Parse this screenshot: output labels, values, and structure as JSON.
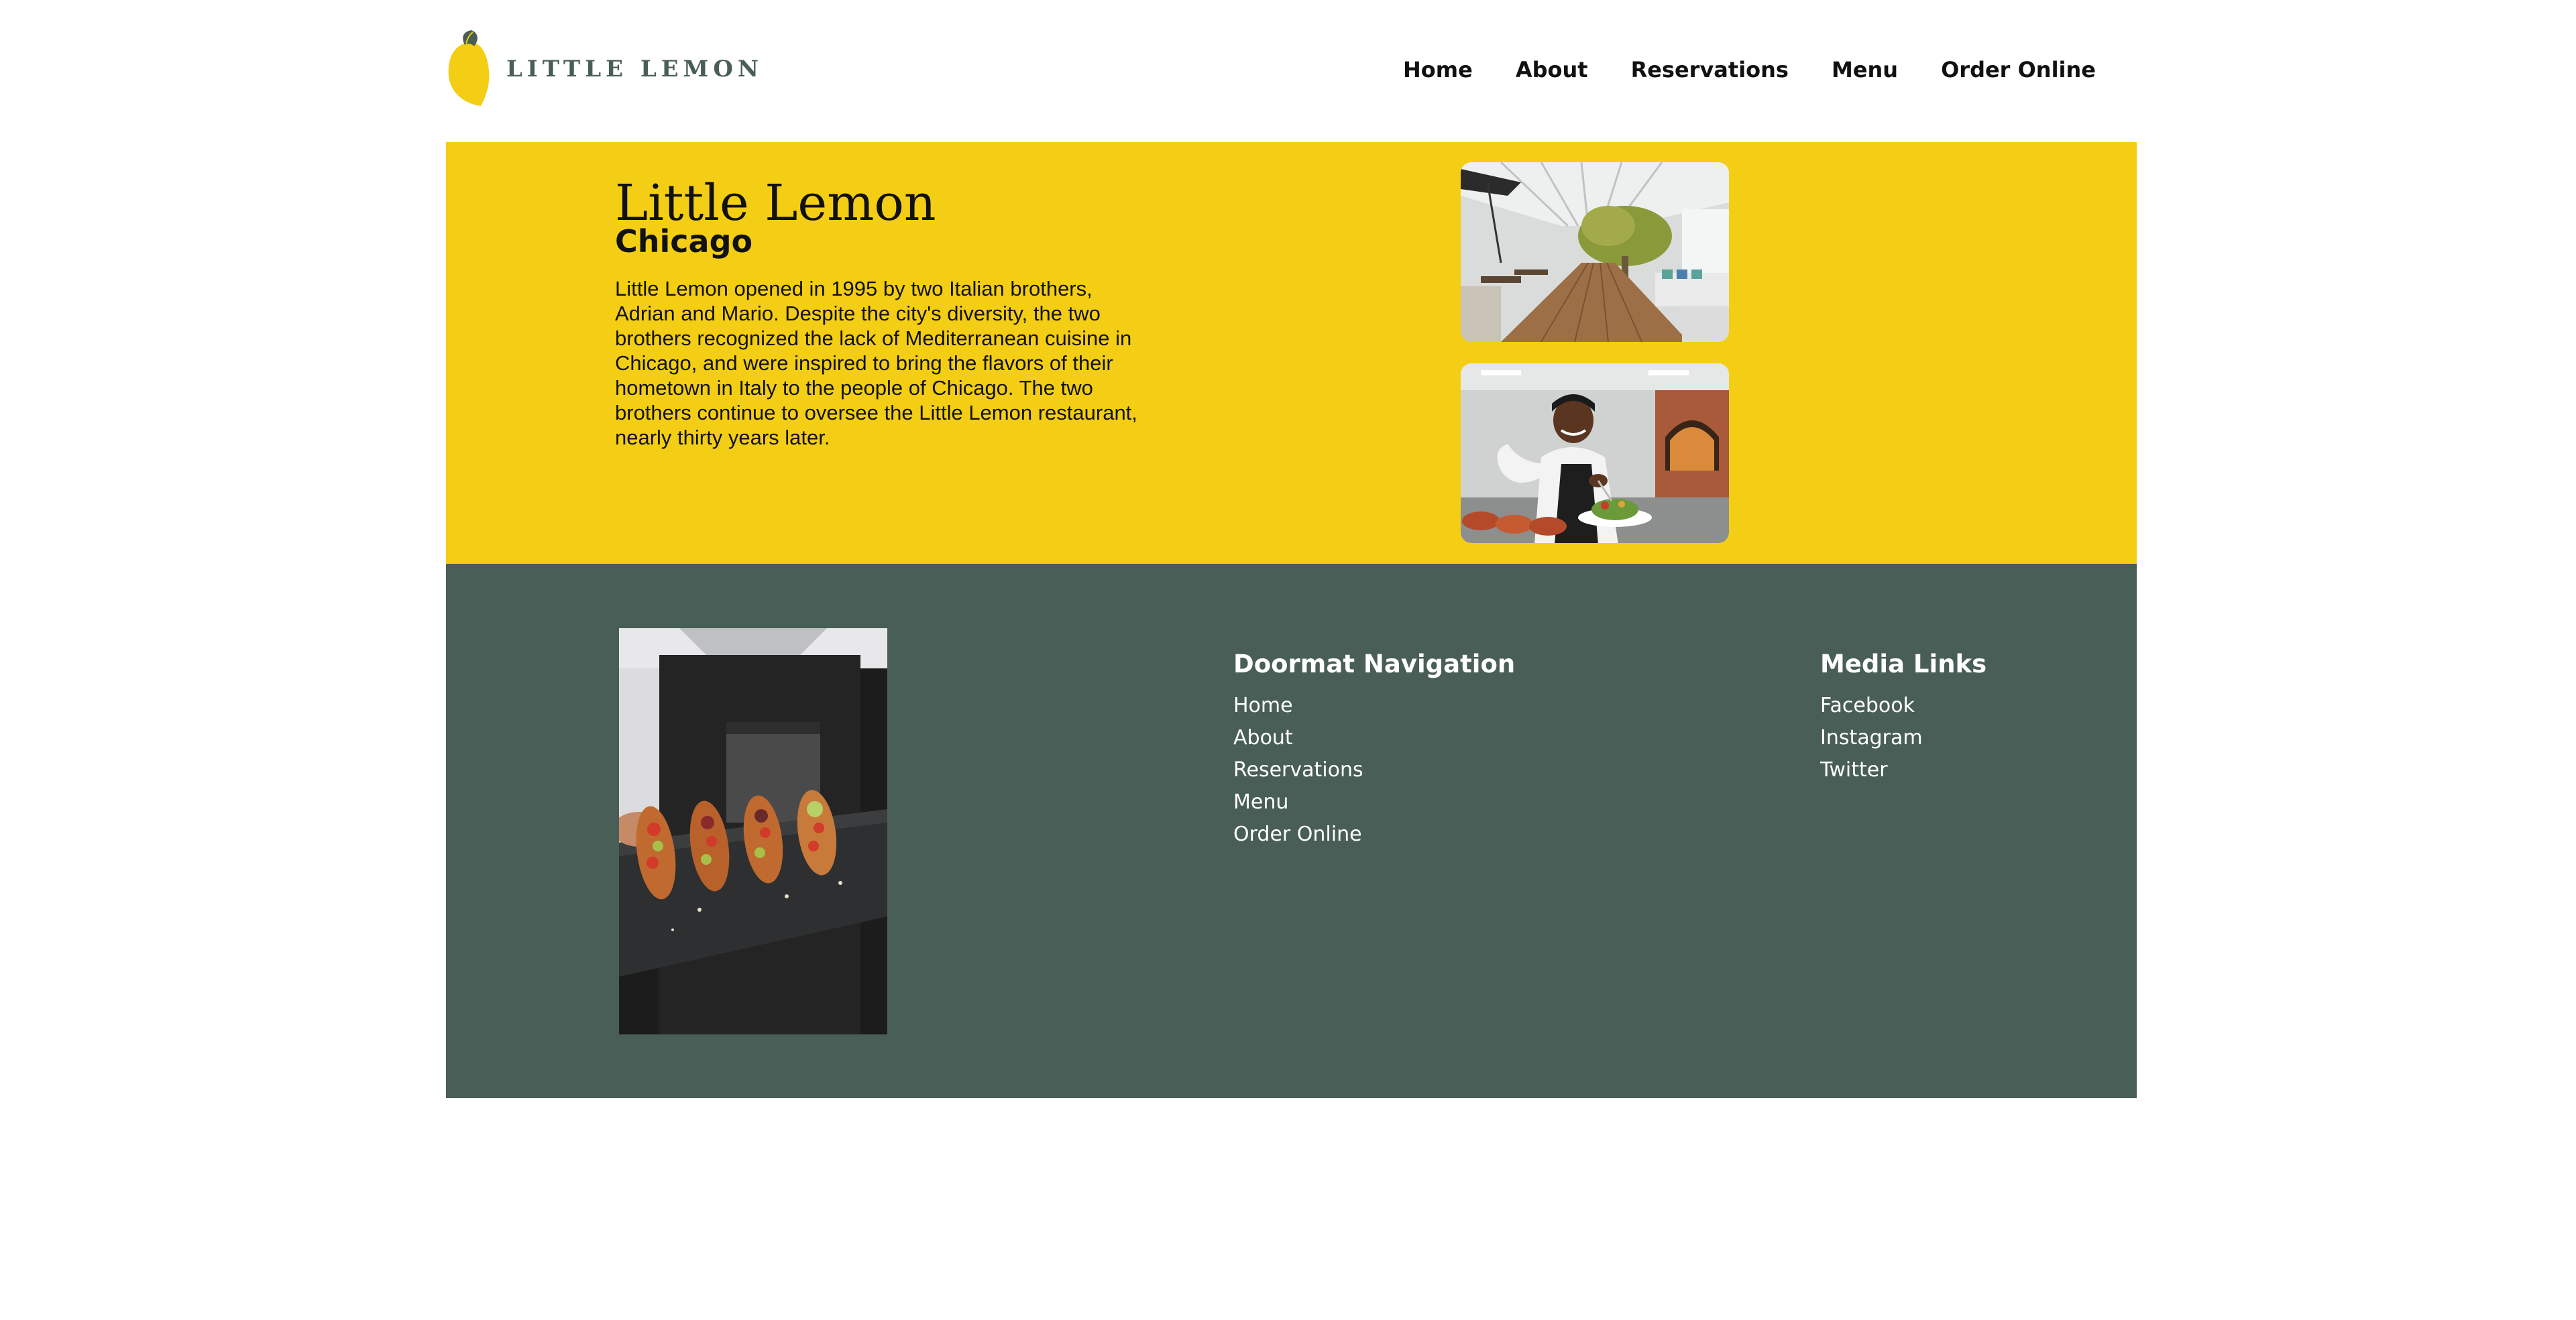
{
  "brand": {
    "name": "LITTLE LEMON",
    "logo_icon": "lemon-icon",
    "colors": {
      "primary_green": "#495E57",
      "primary_yellow": "#F4CE14"
    }
  },
  "nav": {
    "items": [
      {
        "label": "Home"
      },
      {
        "label": "About"
      },
      {
        "label": "Reservations"
      },
      {
        "label": "Menu"
      },
      {
        "label": "Order Online"
      }
    ]
  },
  "hero": {
    "title": "Little Lemon",
    "subtitle": "Chicago",
    "description": "Little Lemon opened in 1995 by two Italian brothers, Adrian and Mario. Despite the city's diversity, the two brothers recognized the lack of Mediterranean cuisine in Chicago, and were inspired to bring the flavors of their hometown in Italy to the people of Chicago. The two brothers continue to oversee the Little Lemon restaurant, nearly thirty years later."
  },
  "footer": {
    "nav_heading": "Doormat Navigation",
    "nav_links": [
      {
        "label": "Home"
      },
      {
        "label": "About"
      },
      {
        "label": "Reservations"
      },
      {
        "label": "Menu"
      },
      {
        "label": "Order Online"
      }
    ],
    "media_heading": "Media Links",
    "media_links": [
      {
        "label": "Facebook"
      },
      {
        "label": "Instagram"
      },
      {
        "label": "Twitter"
      }
    ]
  }
}
